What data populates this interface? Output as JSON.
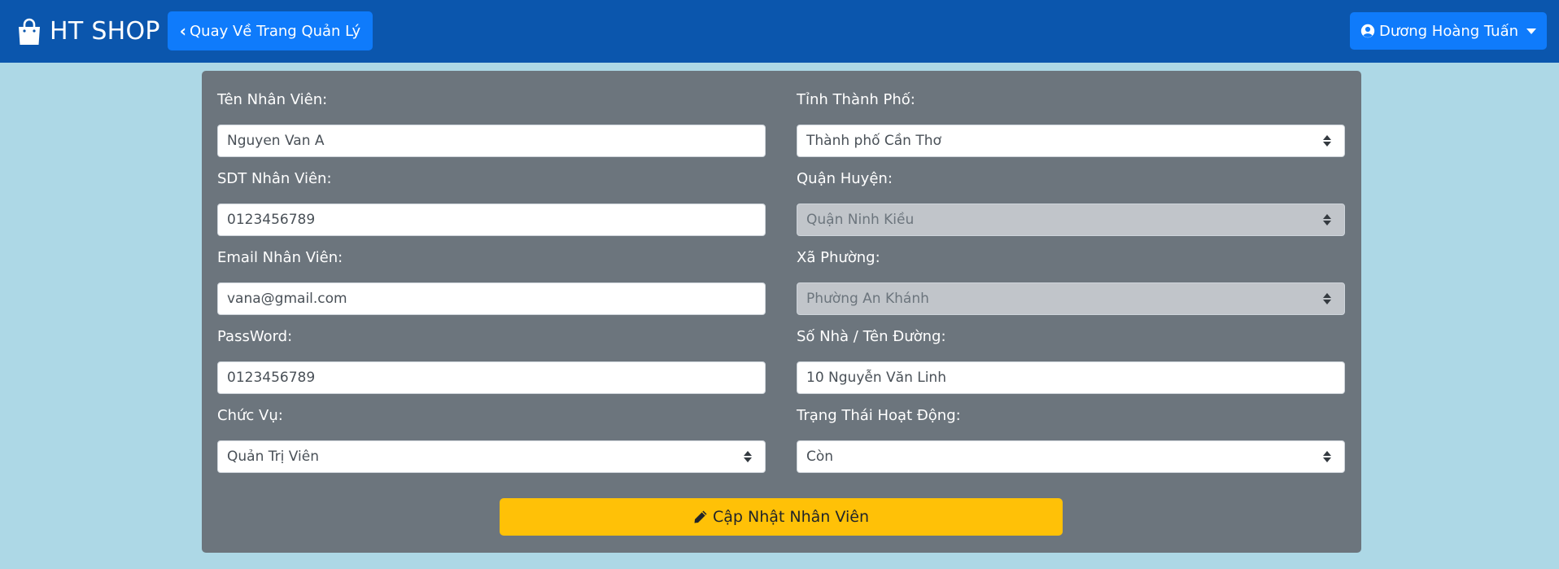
{
  "header": {
    "brand": "HT SHOP",
    "back_label": "Quay Về Trang Quản Lý",
    "user_label": "Dương Hoàng Tuấn"
  },
  "form": {
    "left": [
      {
        "label": "Tên Nhân Viên:",
        "value": "Nguyen Van A",
        "type": "input"
      },
      {
        "label": "SDT Nhân Viên:",
        "value": "0123456789",
        "type": "input"
      },
      {
        "label": "Email Nhân Viên:",
        "value": "vana@gmail.com",
        "type": "input"
      },
      {
        "label": "PassWord:",
        "value": "0123456789",
        "type": "input"
      },
      {
        "label": "Chức Vụ:",
        "value": "Quản Trị Viên",
        "type": "select"
      }
    ],
    "right": [
      {
        "label": "Tỉnh Thành Phố:",
        "value": "Thành phố Cần Thơ",
        "type": "select"
      },
      {
        "label": "Quận Huyện:",
        "value": "Quận Ninh Kiều",
        "type": "select",
        "disabled": true
      },
      {
        "label": "Xã Phường:",
        "value": "Phường An Khánh",
        "type": "select",
        "disabled": true
      },
      {
        "label": "Số Nhà / Tên Đường:",
        "value": "10 Nguyễn Văn Linh",
        "type": "input"
      },
      {
        "label": "Trạng Thái Hoạt Động:",
        "value": "Còn",
        "type": "select"
      }
    ],
    "submit_label": "Cập Nhật Nhân Viên"
  },
  "colors": {
    "navbar": "#0b56ad",
    "primary": "#0f7bfb",
    "background": "#add8e6",
    "panel": "#6c757d",
    "warning": "#ffc107"
  }
}
